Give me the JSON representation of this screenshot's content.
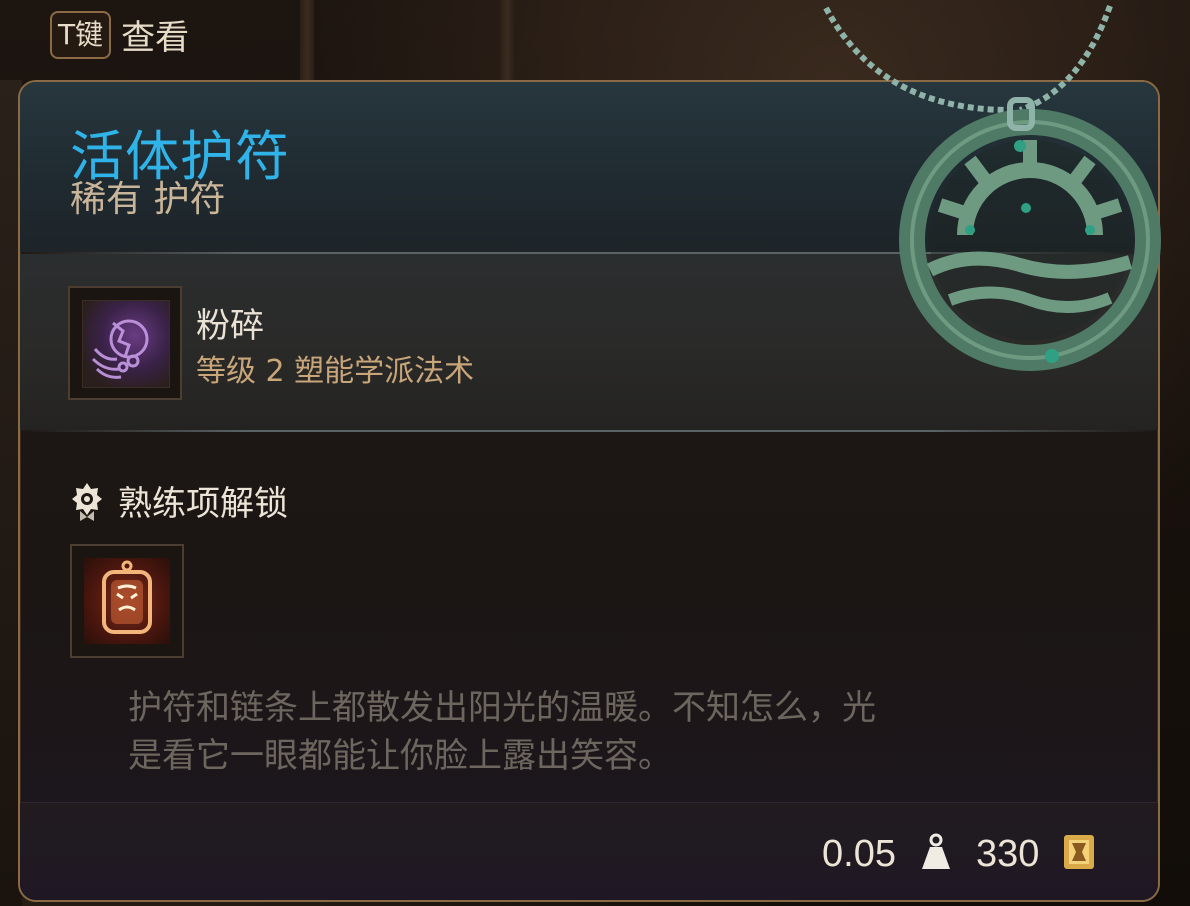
{
  "hotkey": {
    "key": "T键",
    "action": "查看"
  },
  "item": {
    "name": "活体护符",
    "rarity_type": "稀有 护符",
    "name_color": "#2fb3e8",
    "icon": "sun-amulet-icon"
  },
  "spell": {
    "name": "粉碎",
    "description": "等级 2 塑能学派法术",
    "icon": "shatter-spell-icon"
  },
  "proficiency": {
    "label": "熟练项解锁",
    "icon": "proficiency-badge-icon",
    "unlock_icon": "amulet-proficiency-icon"
  },
  "flavor_text": {
    "line1": "护符和链条上都散发出阳光的温暖。不知怎么，光",
    "line2": "是看它一眼都能让你脸上露出笑容。"
  },
  "footer": {
    "weight": "0.05",
    "weight_icon": "weight-icon",
    "price": "330",
    "gold_icon": "gold-coin-icon"
  },
  "colors": {
    "border": "#8a6a45",
    "subtitle": "#c9b59a",
    "spell_subtext": "#c9a57a",
    "flavor": "#6d665f"
  }
}
